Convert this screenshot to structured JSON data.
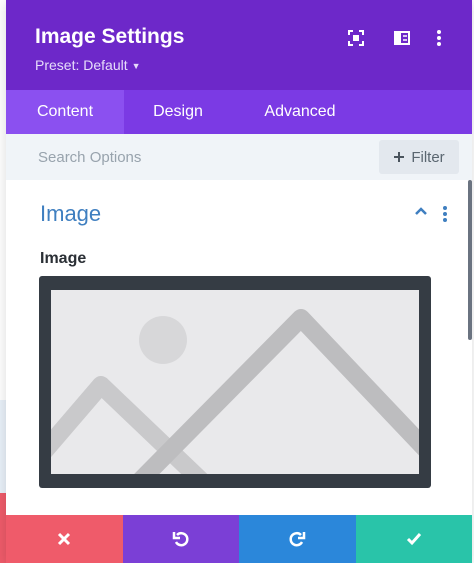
{
  "header": {
    "title": "Image Settings",
    "preset_label": "Preset: Default",
    "icons": [
      "fullscreen-icon",
      "split-view-icon",
      "more-vertical-icon"
    ]
  },
  "tabs": [
    {
      "label": "Content",
      "active": true
    },
    {
      "label": "Design",
      "active": false
    },
    {
      "label": "Advanced",
      "active": false
    }
  ],
  "search": {
    "placeholder": "Search Options",
    "filter_label": "Filter"
  },
  "section": {
    "title": "Image",
    "expanded": true,
    "field_label": "Image"
  },
  "footer": {
    "buttons": [
      {
        "name": "discard",
        "icon": "close-icon",
        "color": "#ef5b6a"
      },
      {
        "name": "undo",
        "icon": "undo-icon",
        "color": "#7b3fd6"
      },
      {
        "name": "redo",
        "icon": "redo-icon",
        "color": "#2b87da"
      },
      {
        "name": "save",
        "icon": "check-icon",
        "color": "#29c4a9"
      }
    ]
  },
  "colors": {
    "header": "#6d28c9",
    "tabs": "#7b3ae4",
    "active_tab": "#8b50f0",
    "section_title": "#3f7fc0"
  }
}
